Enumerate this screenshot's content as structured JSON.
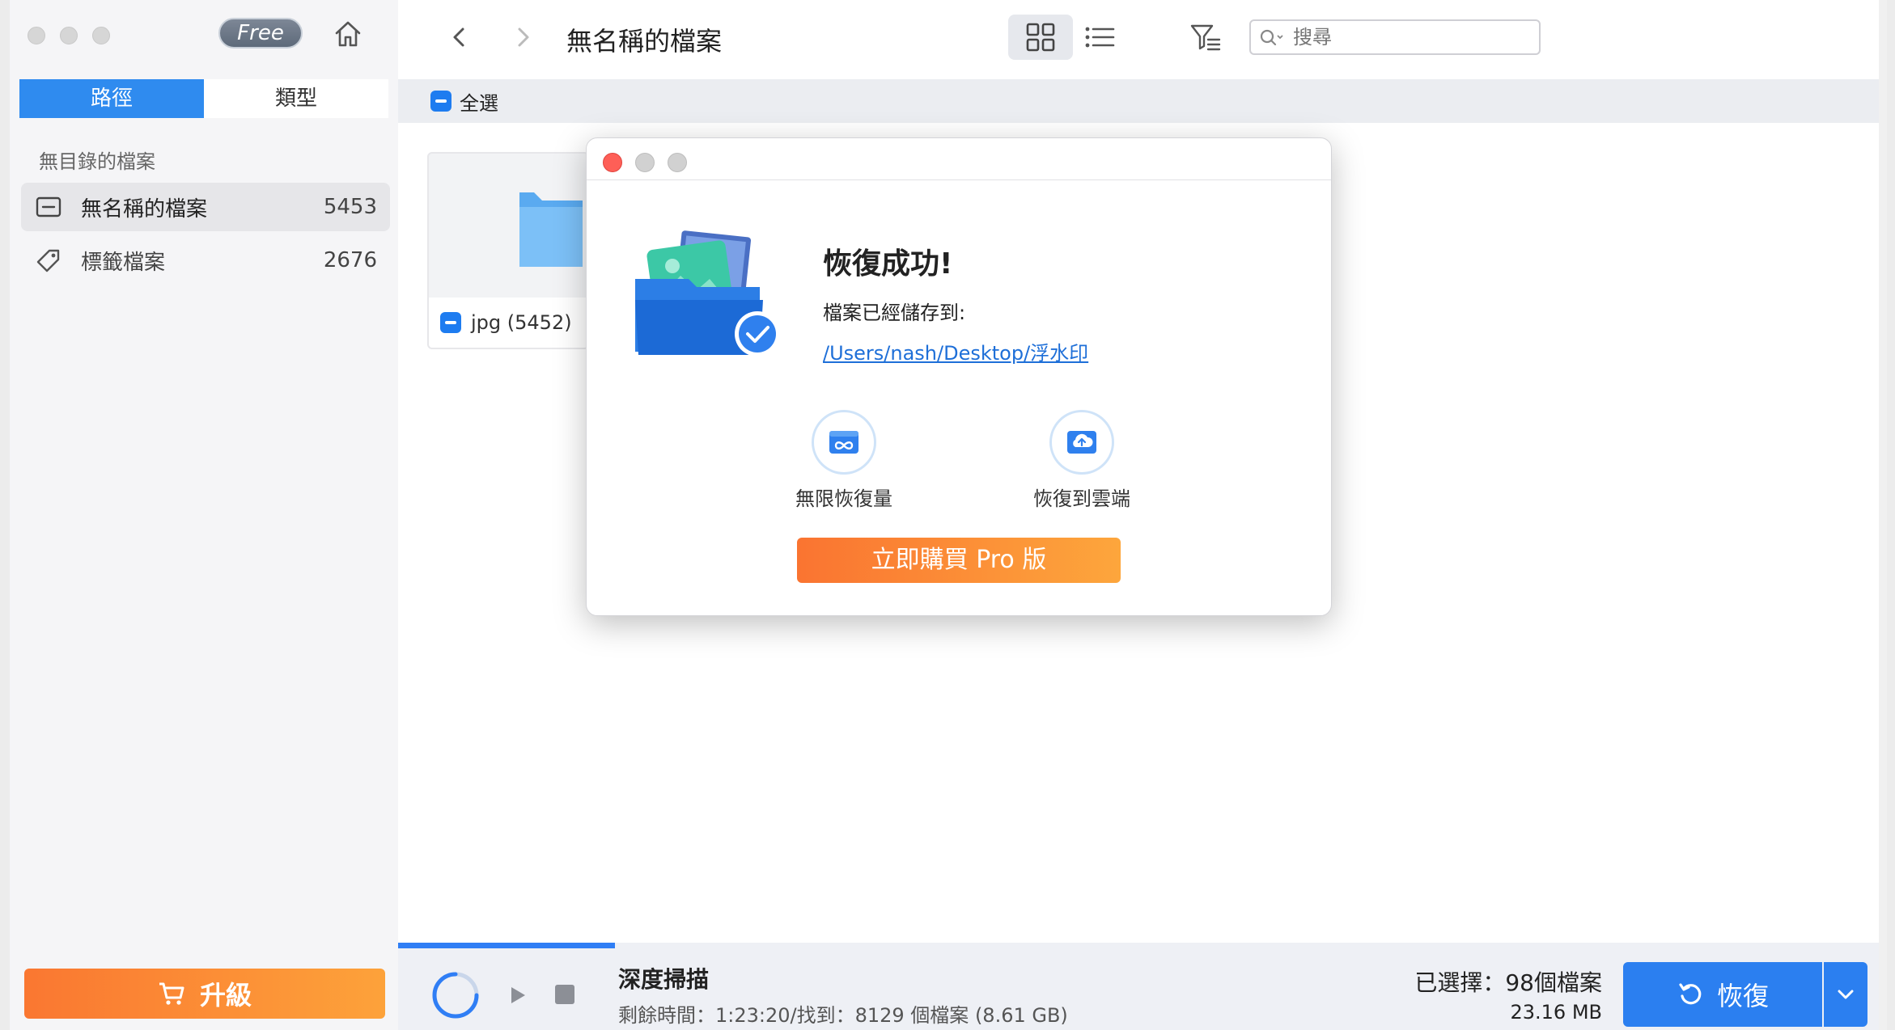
{
  "sidebar": {
    "free_badge": "Free",
    "tabs": [
      {
        "label": "路徑",
        "active": true
      },
      {
        "label": "類型",
        "active": false
      }
    ],
    "section_label": "無目錄的檔案",
    "items": [
      {
        "label": "無名稱的檔案",
        "count": "5453",
        "icon": "folder-minus-icon",
        "selected": true
      },
      {
        "label": "標籤檔案",
        "count": "2676",
        "icon": "tag-icon",
        "selected": false
      }
    ],
    "upgrade_label": "升級"
  },
  "toolbar": {
    "title": "無名稱的檔案",
    "search_placeholder": "搜尋"
  },
  "content": {
    "select_all_label": "全選",
    "file_card_label": "jpg (5452)"
  },
  "dialog": {
    "heading": "恢復成功!",
    "saved_label": "檔案已經儲存到:",
    "path": "/Users/nash/Desktop/浮水印",
    "feature1": "無限恢復量",
    "feature2": "恢復到雲端",
    "buy_label": "立即購買 Pro 版"
  },
  "footer": {
    "scan_title": "深度掃描",
    "scan_info": "剩餘時間：1:23:20/找到：8129 個檔案 (8.61 GB)",
    "scan_progress": 0.145,
    "selected_count": "已選擇：98個檔案",
    "selected_size": "23.16 MB",
    "recover_label": "恢復"
  },
  "colors": {
    "accent": "#2b7ff0",
    "upgrade": "#fa7731",
    "close": "#fe5f57"
  }
}
